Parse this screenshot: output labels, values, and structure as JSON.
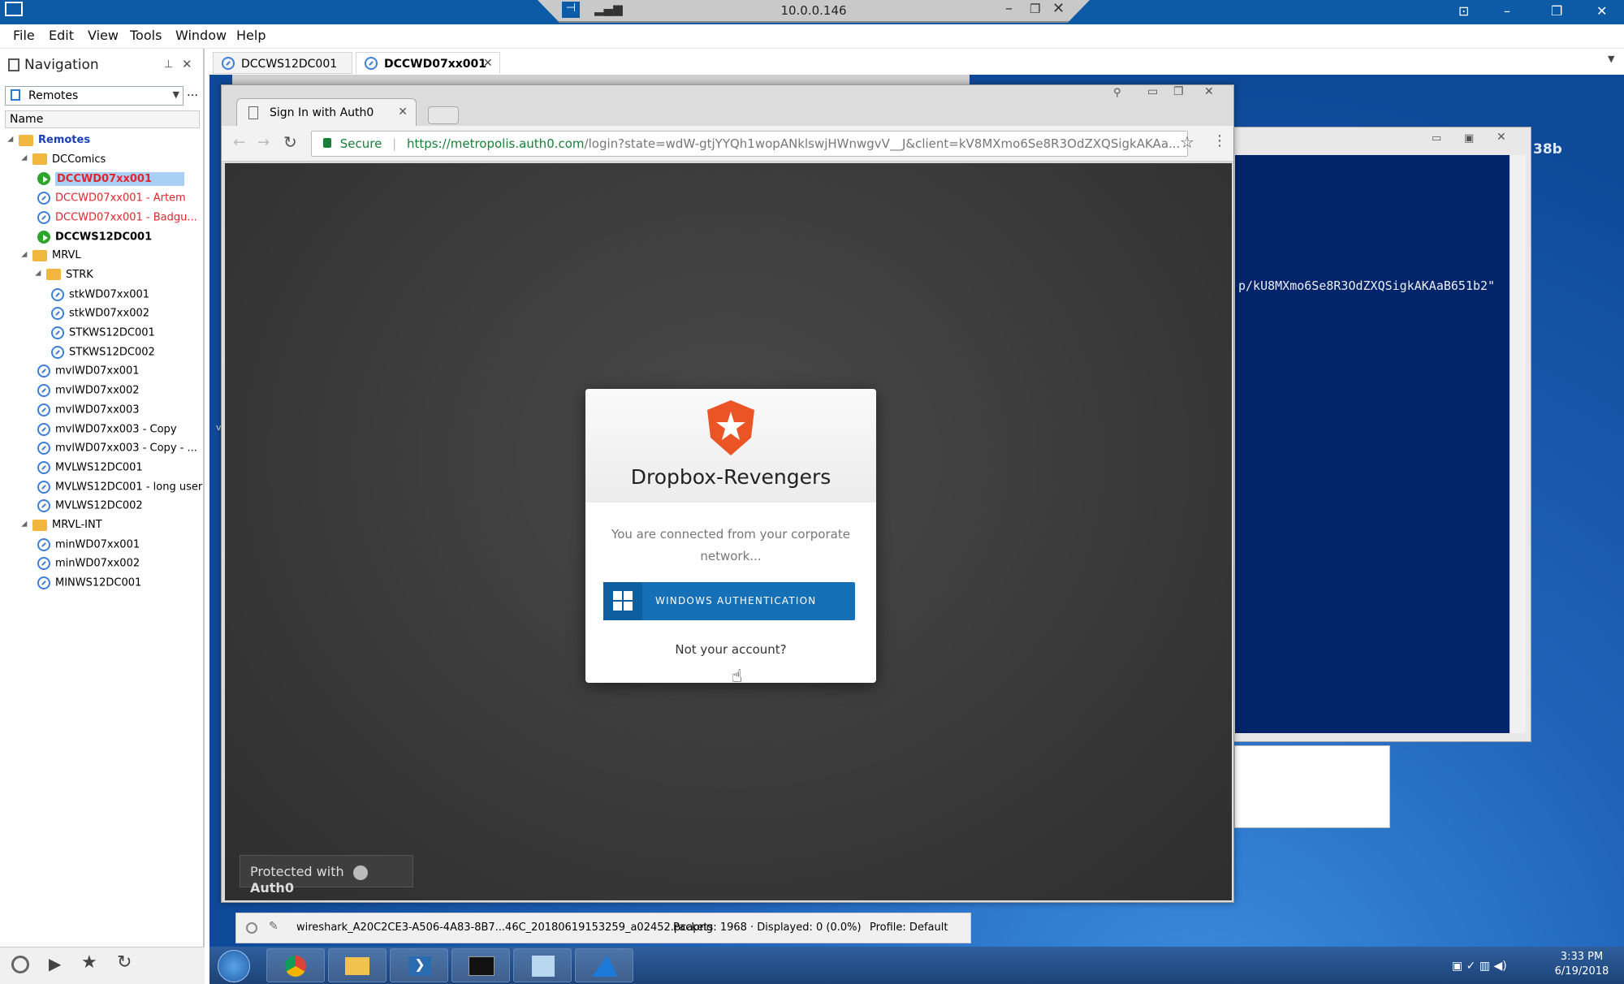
{
  "rdp": {
    "ip": "10.0.0.146"
  },
  "menu": [
    "File",
    "Edit",
    "View",
    "Tools",
    "Window",
    "Help"
  ],
  "nav": {
    "title": "Navigation",
    "filter": "Remotes",
    "column": "Name",
    "tree": [
      {
        "label": "Remotes",
        "level": 0,
        "kind": "folder",
        "style": "bold-blue"
      },
      {
        "label": "DCComics",
        "level": 1,
        "kind": "folder"
      },
      {
        "label": "DCCWD07xx001",
        "level": 2,
        "kind": "on",
        "style": "red-selected"
      },
      {
        "label": "DCCWD07xx001 - Artem",
        "level": 2,
        "kind": "conn",
        "style": "red"
      },
      {
        "label": "DCCWD07xx001 - Badgu...",
        "level": 2,
        "kind": "conn",
        "style": "red"
      },
      {
        "label": "DCCWS12DC001",
        "level": 2,
        "kind": "on",
        "style": "bold"
      },
      {
        "label": "MRVL",
        "level": 1,
        "kind": "folder"
      },
      {
        "label": "STRK",
        "level": 2,
        "kind": "folder"
      },
      {
        "label": "stkWD07xx001",
        "level": 3,
        "kind": "conn"
      },
      {
        "label": "stkWD07xx002",
        "level": 3,
        "kind": "conn"
      },
      {
        "label": "STKWS12DC001",
        "level": 3,
        "kind": "conn"
      },
      {
        "label": "STKWS12DC002",
        "level": 3,
        "kind": "conn"
      },
      {
        "label": "mvlWD07xx001",
        "level": 2,
        "kind": "conn"
      },
      {
        "label": "mvlWD07xx002",
        "level": 2,
        "kind": "conn"
      },
      {
        "label": "mvlWD07xx003",
        "level": 2,
        "kind": "conn"
      },
      {
        "label": "mvlWD07xx003 - Copy",
        "level": 2,
        "kind": "conn"
      },
      {
        "label": "mvlWD07xx003 - Copy - ...",
        "level": 2,
        "kind": "conn"
      },
      {
        "label": "MVLWS12DC001",
        "level": 2,
        "kind": "conn"
      },
      {
        "label": "MVLWS12DC001 - long user",
        "level": 2,
        "kind": "conn"
      },
      {
        "label": "MVLWS12DC002",
        "level": 2,
        "kind": "conn"
      },
      {
        "label": "MRVL-INT",
        "level": 1,
        "kind": "folder"
      },
      {
        "label": "minWD07xx001",
        "level": 2,
        "kind": "conn"
      },
      {
        "label": "minWD07xx002",
        "level": 2,
        "kind": "conn"
      },
      {
        "label": "MINWS12DC001",
        "level": 2,
        "kind": "conn"
      }
    ]
  },
  "tabs": [
    "DCCWS12DC001",
    "DCCWD07xx001"
  ],
  "browser": {
    "tab_title": "Sign In with Auth0",
    "secure_label": "Secure",
    "url_host": "https://metropolis.auth0.com",
    "url_path": "/login?state=wdW-gtjYYQh1wopANklswjHWnwgvV__J&client=kV8MXmo6Se8R3OdZXQSigkAKAa..."
  },
  "login": {
    "app_name": "Dropbox-Revengers",
    "message": "You are connected from your corporate network...",
    "button": "WINDOWS AUTHENTICATION",
    "not_you": "Not your account?",
    "protected_prefix": "Protected with",
    "protected_brand": "Auth0"
  },
  "powershell": {
    "line": "p/kU8MXmo6Se8R3OdZXQSigkAKAaB651b2\"",
    "side": "38b"
  },
  "wireshark": {
    "file": "wireshark_A20C2CE3-A506-4A83-8B7...46C_20180619153259_a02452.pcapng",
    "packets": "Packets: 1968 · Displayed: 0 (0.0%)",
    "profile": "Profile: Default"
  },
  "clock": {
    "time": "3:33 PM",
    "date": "6/19/2018"
  }
}
